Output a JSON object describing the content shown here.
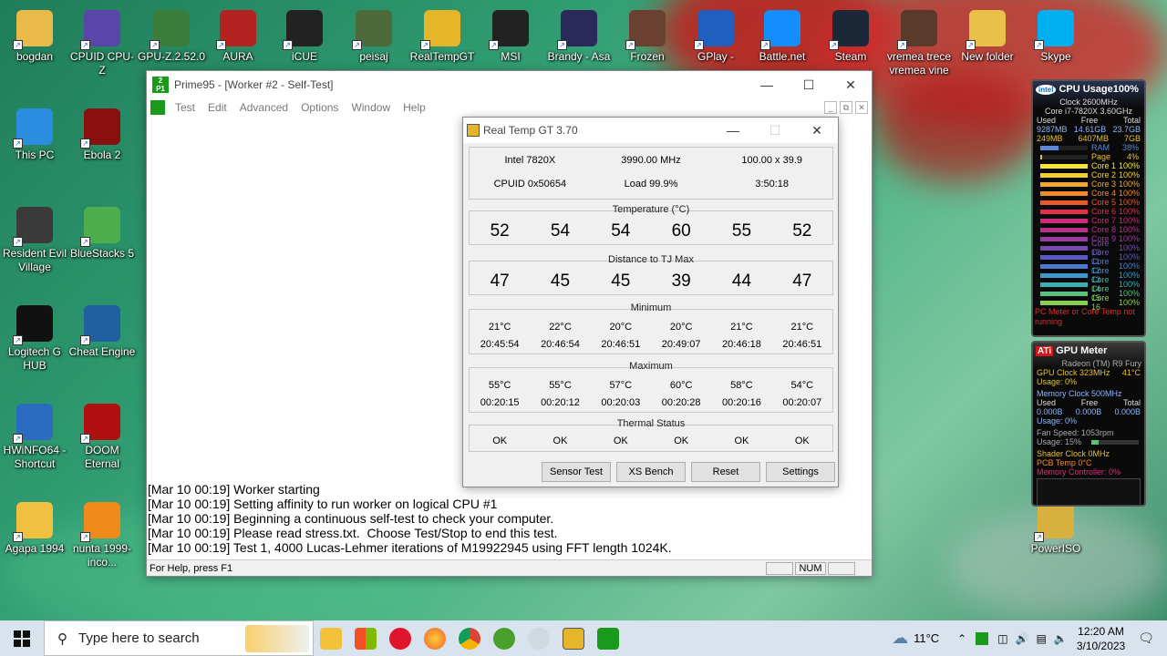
{
  "desktop": {
    "icons": [
      {
        "label": "bogdan",
        "color": "#e9b94a"
      },
      {
        "label": "CPUID CPU-Z",
        "color": "#5a46a8"
      },
      {
        "label": "GPU-Z.2.52.0",
        "color": "#3a7d3b"
      },
      {
        "label": "AURA",
        "color": "#b52222"
      },
      {
        "label": "iCUE",
        "color": "#222222"
      },
      {
        "label": "peisaj",
        "color": "#4d6a3c"
      },
      {
        "label": "RealTempGT -",
        "color": "#e5b62a"
      },
      {
        "label": "MSI",
        "color": "#222222"
      },
      {
        "label": "Brandy - Asa",
        "color": "#2a2a5a"
      },
      {
        "label": "Frozen",
        "color": "#6a4030"
      },
      {
        "label": "GPlay -",
        "color": "#1f5fbf"
      },
      {
        "label": "Battle.net",
        "color": "#148eff"
      },
      {
        "label": "Steam",
        "color": "#1b2838"
      },
      {
        "label": "vremea trece vremea vine",
        "color": "#5a3a2a"
      },
      {
        "label": "New folder",
        "color": "#e9c04a"
      },
      {
        "label": "Skype",
        "color": "#00aff0"
      },
      {
        "label": "This PC",
        "color": "#2a8de0"
      },
      {
        "label": "Ebola 2",
        "color": "#8a1010"
      },
      {
        "label": "Resident Evil Village",
        "color": "#3a3a3a"
      },
      {
        "label": "BlueStacks 5",
        "color": "#4cae4c"
      },
      {
        "label": "Logitech G HUB",
        "color": "#111111"
      },
      {
        "label": "Cheat Engine",
        "color": "#2060a0"
      },
      {
        "label": "HWiNFO64 - Shortcut",
        "color": "#2a6cc0"
      },
      {
        "label": "DOOM Eternal",
        "color": "#b01010"
      },
      {
        "label": "Agapa 1994",
        "color": "#f0c040"
      },
      {
        "label": "nunta 1999-inco...",
        "color": "#f08a1a"
      },
      {
        "label": "PowerISO",
        "color": "#d8b040"
      }
    ]
  },
  "prime95": {
    "title": "Prime95 - [Worker #2 - Self-Test]",
    "menu": [
      "Test",
      "Edit",
      "Advanced",
      "Options",
      "Window",
      "Help"
    ],
    "log": [
      "[Mar 10 00:19] Worker starting",
      "[Mar 10 00:19] Setting affinity to run worker on logical CPU #1",
      "[Mar 10 00:19] Beginning a continuous self-test to check your computer.",
      "[Mar 10 00:19] Please read stress.txt.  Choose Test/Stop to end this test.",
      "[Mar 10 00:19] Test 1, 4000 Lucas-Lehmer iterations of M19922945 using FFT length 1024K."
    ],
    "status": "For Help, press F1",
    "num": "NUM"
  },
  "realtemp": {
    "title": "Real Temp GT 3.70",
    "cpu": "Intel 7820X",
    "mhz": "3990.00 MHz",
    "mult": "100.00 x 39.9",
    "cpuid": "CPUID  0x50654",
    "load": "Load  99.9%",
    "time": "3:50:18",
    "temp_label": "Temperature (°C)",
    "temps": [
      "52",
      "54",
      "54",
      "60",
      "55",
      "52"
    ],
    "dist_label": "Distance to TJ Max",
    "dist": [
      "47",
      "45",
      "45",
      "39",
      "44",
      "47"
    ],
    "min_label": "Minimum",
    "min_temps": [
      "21°C",
      "22°C",
      "20°C",
      "20°C",
      "21°C",
      "21°C"
    ],
    "min_times": [
      "20:45:54",
      "20:46:54",
      "20:46:51",
      "20:49:07",
      "20:46:18",
      "20:46:51"
    ],
    "max_label": "Maximum",
    "max_temps": [
      "55°C",
      "55°C",
      "57°C",
      "60°C",
      "58°C",
      "54°C"
    ],
    "max_times": [
      "00:20:15",
      "00:20:12",
      "00:20:03",
      "00:20:28",
      "00:20:16",
      "00:20:07"
    ],
    "thermal_label": "Thermal Status",
    "thermal": [
      "OK",
      "OK",
      "OK",
      "OK",
      "OK",
      "OK"
    ],
    "buttons": [
      "Sensor Test",
      "XS Bench",
      "Reset",
      "Settings"
    ]
  },
  "cpu_gadget": {
    "title": "CPU Usage",
    "total": "100%",
    "brand": "intel",
    "clock": "Clock 2600MHz",
    "model": "Core i7-7820X 3.60GHz",
    "headers": [
      "Used",
      "Free",
      "Total"
    ],
    "ram_row": [
      "9287MB",
      "14.61GB",
      "23.7GB"
    ],
    "page_row": [
      "249MB",
      "6407MB",
      "7GB"
    ],
    "bars": [
      {
        "label": "RAM",
        "value": "38%",
        "level": 0.38,
        "color": "#5b8ad8"
      },
      {
        "label": "Page",
        "value": "4%",
        "level": 0.04,
        "color": "#e8c12a"
      },
      {
        "label": "Core 1",
        "value": "100%",
        "level": 1,
        "color": "#f5e63a"
      },
      {
        "label": "Core 2",
        "value": "100%",
        "level": 1,
        "color": "#f2d030"
      },
      {
        "label": "Core 3",
        "value": "100%",
        "level": 1,
        "color": "#f0a830"
      },
      {
        "label": "Core 4",
        "value": "100%",
        "level": 1,
        "color": "#f08a2a"
      },
      {
        "label": "Core 5",
        "value": "100%",
        "level": 1,
        "color": "#e85a2a"
      },
      {
        "label": "Core 6",
        "value": "100%",
        "level": 1,
        "color": "#e0304a"
      },
      {
        "label": "Core 7",
        "value": "100%",
        "level": 1,
        "color": "#d02a7a"
      },
      {
        "label": "Core 8",
        "value": "100%",
        "level": 1,
        "color": "#b8308a"
      },
      {
        "label": "Core 9",
        "value": "100%",
        "level": 1,
        "color": "#9a3aa0"
      },
      {
        "label": "Core 10",
        "value": "100%",
        "level": 1,
        "color": "#7a4ab0"
      },
      {
        "label": "Core 11",
        "value": "100%",
        "level": 1,
        "color": "#5a5ac0"
      },
      {
        "label": "Core 12",
        "value": "100%",
        "level": 1,
        "color": "#4a7ad0"
      },
      {
        "label": "Core 13",
        "value": "100%",
        "level": 1,
        "color": "#3a9ad0"
      },
      {
        "label": "Core 14",
        "value": "100%",
        "level": 1,
        "color": "#3ab0b0"
      },
      {
        "label": "Core 15",
        "value": "100%",
        "level": 1,
        "color": "#5ac080"
      },
      {
        "label": "Core 16",
        "value": "100%",
        "level": 1,
        "color": "#8ad050"
      }
    ],
    "footer1": "PC Meter or Core Temp not",
    "footer2": "running"
  },
  "gpu_gadget": {
    "brand": "ATi",
    "title": "GPU Meter",
    "model": "Radeon (TM) R9 Fury",
    "gpu_clock": "GPU Clock 323MHz",
    "gpu_temp": "41°C",
    "usage0": "Usage: 0%",
    "mem_clock": "Memory Clock 500MHz",
    "headers": [
      "Used",
      "Free",
      "Total"
    ],
    "mem_row": [
      "0.000B",
      "0.000B",
      "0.000B"
    ],
    "usage1": "Usage: 0%",
    "fan": "Fan Speed: 1053rpm",
    "fan_usage": "Usage: 15%",
    "fan_level": 0.15,
    "shader": "Shader Clock 0MHz",
    "pcb": "PCB Temp 0°C",
    "memctrl": "Memory Controller: 0%"
  },
  "taskbar": {
    "search_placeholder": "Type here to search",
    "weather": "11°C",
    "time": "12:20 AM",
    "date": "3/10/2023"
  }
}
